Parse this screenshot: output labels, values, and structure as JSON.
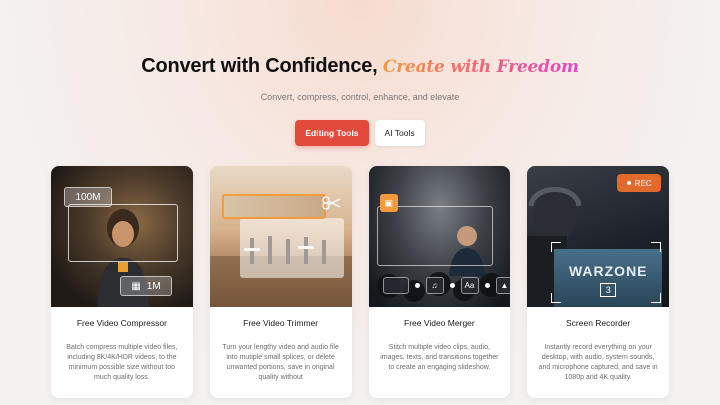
{
  "hero": {
    "headline_main": "Convert with Confidence,",
    "headline_accent": "Create with Freedom",
    "subline": "Convert, compress, control, enhance, and elevate"
  },
  "tabs": [
    {
      "label": "Editing Tools",
      "active": true
    },
    {
      "label": "AI Tools",
      "active": false
    }
  ],
  "cards": [
    {
      "title": "Free Video Compressor",
      "description": "Batch compress multiple video files, including 8K/4K/HDR videos, to the minimum possible size without too much quality loss.",
      "overlay_before": "100M",
      "overlay_after": "1M"
    },
    {
      "title": "Free Video Trimmer",
      "description": "Turn your lengthy video and audio file into mutiple small splices, or delete unwanted portions, save in original quality without"
    },
    {
      "title": "Free Video Merger",
      "description": "Stitch multiple video clips, audio, images, texts, and transitions together to create an engaging slideshow.",
      "chip_text": "Aa"
    },
    {
      "title": "Screen Recorder",
      "description": "Instantly record everything on your desktop, with audio, system sounds, and microphone captured, and save in 1080p and 4K quality.",
      "rec_label": "REC",
      "screen_text": "WARZONE",
      "screen_number": "3"
    }
  ],
  "colors": {
    "accent_red": "#e24a3b",
    "accent_orange": "#f39a3a",
    "accent_pink": "#e149c5"
  }
}
